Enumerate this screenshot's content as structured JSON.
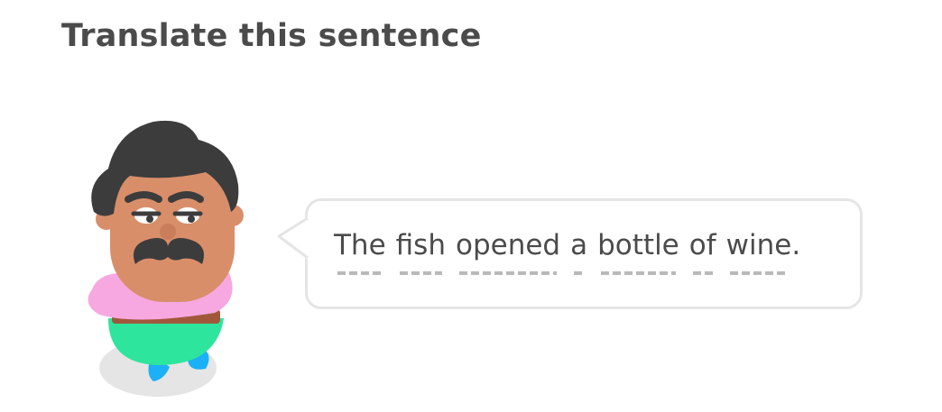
{
  "prompt": {
    "title": "Translate this sentence"
  },
  "sentence": {
    "words": [
      "The",
      "fish",
      "opened",
      "a",
      "bottle",
      "of",
      "wine",
      "."
    ]
  },
  "colors": {
    "text": "#4b4b4b",
    "bubble_border": "#e5e5e5",
    "hint_underline": "#b9b9b9",
    "hair": "#3c3c3c",
    "skin": "#d98e6a",
    "shirt": "#f7a8e0",
    "pants": "#2ee59d",
    "shoes": "#1cb0f6",
    "belt": "#a0583a",
    "shadow": "#e5e5e5"
  }
}
